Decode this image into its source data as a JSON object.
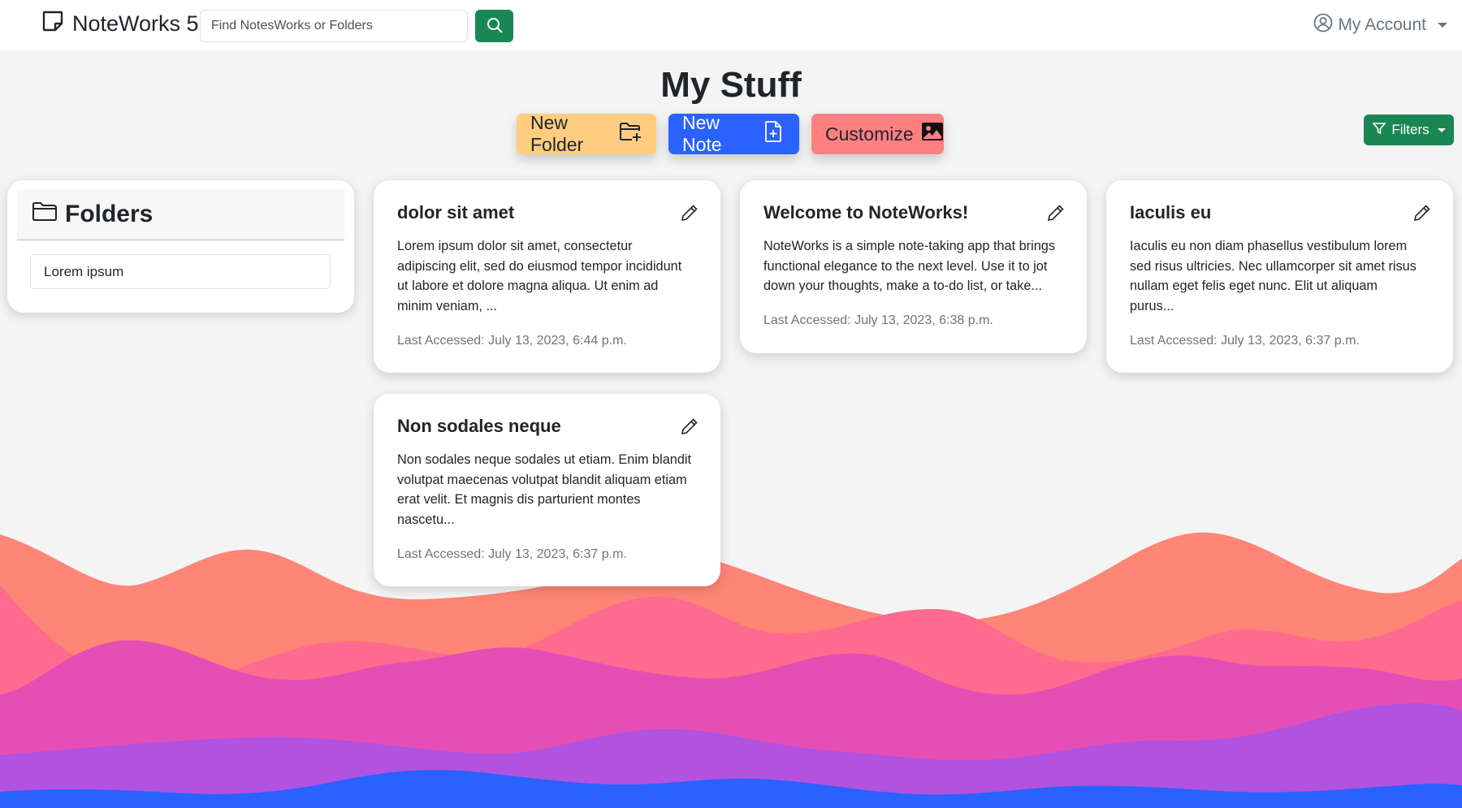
{
  "navbar": {
    "brand": "NoteWorks 5",
    "search_placeholder": "Find NotesWorks or Folders",
    "account_label": "My Account"
  },
  "page": {
    "title": "My Stuff",
    "actions": {
      "new_folder": "New Folder",
      "new_note": "New Note",
      "customize": "Customize"
    },
    "filters_label": "Filters"
  },
  "folders": {
    "heading": "Folders",
    "items": [
      {
        "label": "Lorem ipsum"
      }
    ]
  },
  "notes": [
    {
      "title": "dolor sit amet",
      "lines": [
        "Lorem ipsum dolor sit amet, consectetur",
        "adipiscing elit, sed do eiusmod tempor incididunt",
        "ut labore et dolore magna aliqua. Ut enim ad",
        "minim veniam, ..."
      ],
      "last_accessed": "Last Accessed: July 13, 2023, 6:44 p.m."
    },
    {
      "title": "Welcome to NoteWorks!",
      "lines": [
        "NoteWorks is a simple note-taking app that brings",
        "functional elegance to the next level. Use it to jot",
        "down your thoughts, make a to-do list, or take..."
      ],
      "last_accessed": "Last Accessed: July 13, 2023, 6:38 p.m."
    },
    {
      "title": "Iaculis eu",
      "lines": [
        "Iaculis eu non diam phasellus vestibulum lorem",
        "sed risus ultricies. Nec ullamcorper sit amet risus",
        "nullam eget felis eget nunc. Elit ut aliquam",
        "purus..."
      ],
      "last_accessed": "Last Accessed: July 13, 2023, 6:37 p.m."
    },
    {
      "title": "Non sodales neque",
      "lines": [
        "Non sodales neque sodales ut etiam. Enim blandit",
        "volutpat maecenas volutpat blandit aliquam etiam",
        "erat velit. Et magnis dis parturient montes",
        "nascetu..."
      ],
      "last_accessed": "Last Accessed: July 13, 2023, 6:37 p.m."
    }
  ],
  "colors": {
    "success_green": "#198754",
    "folder_button": "#ffcd80",
    "note_button": "#2962ff",
    "customize_button": "#ff8080",
    "wave_1": "#ff8577",
    "wave_2": "#fe6b8f",
    "wave_3": "#e54fb5",
    "wave_4": "#b152e0",
    "wave_5": "#2962ff"
  },
  "icons": {
    "brand": "sticky-note-icon",
    "search": "search-icon",
    "account": "person-circle-icon",
    "new_folder": "folder-plus-icon",
    "new_note": "file-plus-icon",
    "customize": "image-icon",
    "filters": "funnel-icon",
    "folders": "folder-icon",
    "edit": "pencil-icon"
  }
}
